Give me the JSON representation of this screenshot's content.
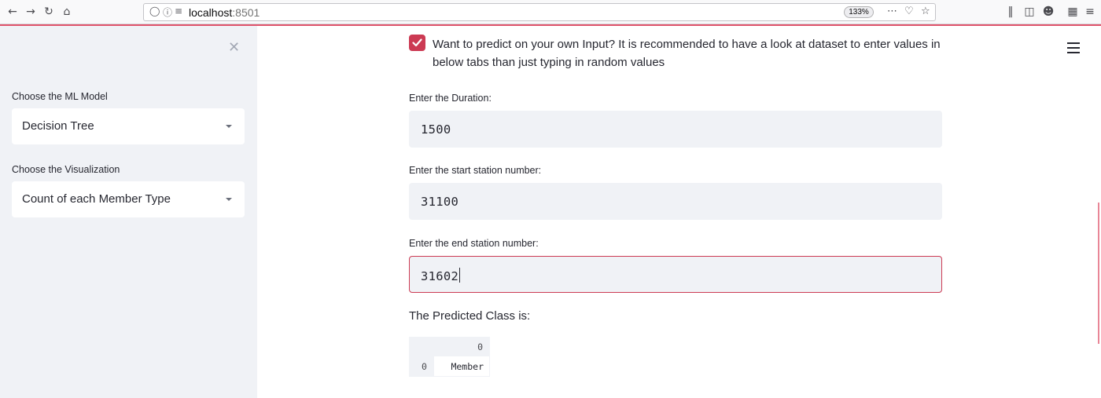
{
  "browser": {
    "url_host": "localhost",
    "url_port": ":8501",
    "zoom": "133%",
    "icons": {
      "back": "back-arrow-icon",
      "forward": "forward-arrow-icon",
      "reload": "reload-icon",
      "home": "home-icon",
      "shield": "tracking-shield-icon",
      "info": "info-icon",
      "permissions": "permissions-icon",
      "more": "more-dots-icon",
      "pocket": "pocket-icon",
      "bookmark": "bookmark-star-icon",
      "library": "library-icon",
      "sidebar": "sidebar-icon",
      "account": "account-icon",
      "extensions": "extensions-icon",
      "menu": "app-menu-icon"
    }
  },
  "sidebar": {
    "close_icon": "close-icon",
    "model_label": "Choose the ML Model",
    "model_value": "Decision Tree",
    "viz_label": "Choose the Visualization",
    "viz_value": "Count of each Member Type"
  },
  "main": {
    "checkbox_text": "Want to predict on your own Input? It is recommended to have a look at dataset to enter values in below tabs than just typing in random values",
    "checkbox_checked": true,
    "duration_label": "Enter the Duration:",
    "duration_value": "1500",
    "start_label": "Enter the start station number:",
    "start_value": "31100",
    "end_label": "Enter the end station number:",
    "end_value": "31602",
    "predicted_label": "The Predicted Class is:",
    "table": {
      "column": "0",
      "index": "0",
      "value": "Member"
    }
  },
  "colors": {
    "accent": "#cc3a53",
    "sidebar_bg": "#f0f2f6",
    "text": "#262730"
  }
}
